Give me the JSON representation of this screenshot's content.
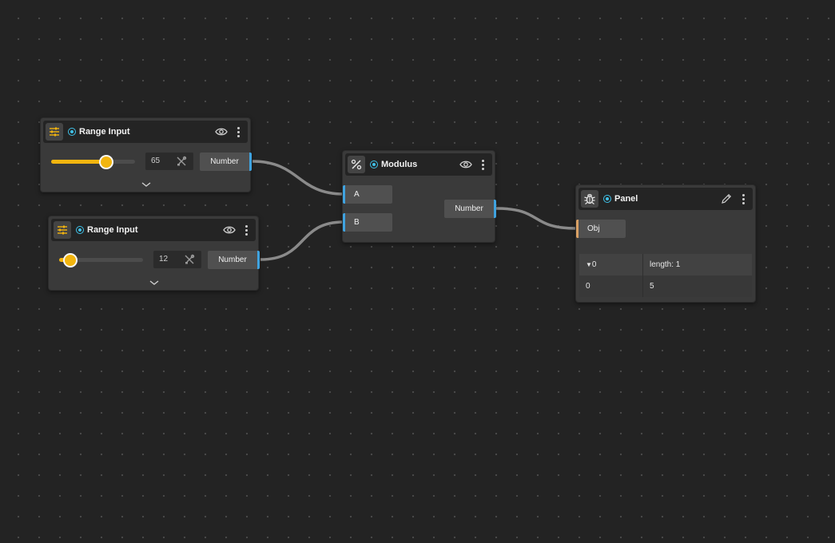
{
  "colors": {
    "background": "#232323",
    "node_body": "#3a3a3a",
    "node_header": "#242424",
    "slider_accent": "#f2b50f",
    "number_port": "#3fa3e0",
    "obj_port": "#d9a064",
    "status_dot": "#3fc1e8",
    "wire": "#8a8a8a"
  },
  "nodes": {
    "range1": {
      "title": "Range Input",
      "icon": "sliders-icon",
      "value": "65",
      "slider_fraction": 0.65,
      "output_label": "Number"
    },
    "range2": {
      "title": "Range Input",
      "icon": "sliders-icon",
      "value": "12",
      "slider_fraction": 0.12,
      "output_label": "Number"
    },
    "modulus": {
      "title": "Modulus",
      "icon": "percent-icon",
      "input_a": "A",
      "input_b": "B",
      "output_label": "Number"
    },
    "panel": {
      "title": "Panel",
      "icon": "bug-icon",
      "input_label": "Obj",
      "rows": [
        {
          "key": "0",
          "value": "length: 1",
          "expanded": true
        },
        {
          "key": "0",
          "value": "5"
        }
      ]
    }
  },
  "connections": [
    {
      "from": "range1.Number",
      "to": "modulus.A"
    },
    {
      "from": "range2.Number",
      "to": "modulus.B"
    },
    {
      "from": "modulus.Number",
      "to": "panel.Obj"
    }
  ]
}
